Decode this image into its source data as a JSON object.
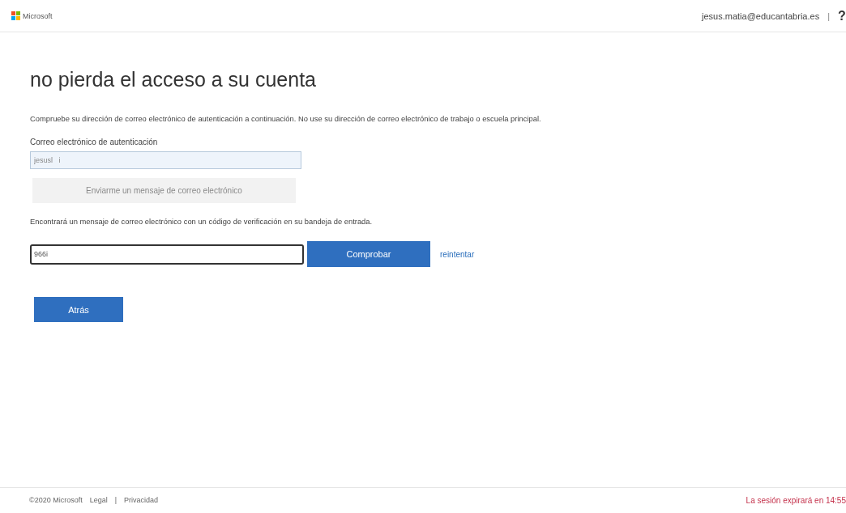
{
  "header": {
    "logo_text": "Microsoft",
    "user_email": "jesus.matia@educantabria.es",
    "separator": "|",
    "help": "?"
  },
  "title": "no pierda el acceso a su cuenta",
  "instructions": "Compruebe su dirección de correo electrónico de autenticación a continuación. No use su dirección de correo electrónico de trabajo o escuela principal.",
  "email_field": {
    "label": "Correo electrónico de autenticación",
    "value": "jesusl   i"
  },
  "send_button": {
    "label": "Enviarme un mensaje de correo electrónico",
    "disabled": true
  },
  "sent_note": "Encontrará un mensaje de correo electrónico con un código de verificación en su bandeja de entrada.",
  "code_field": {
    "value": "966i",
    "focused": true
  },
  "verify_button": {
    "label": "Comprobar"
  },
  "retry_link": "reintentar",
  "back_button": {
    "label": "Atrás"
  },
  "footer": {
    "copyright": "©2020 Microsoft",
    "links": [
      "Legal",
      "Privacidad"
    ],
    "separator": "|",
    "session_notice": "La sesión expirará en 14:55"
  }
}
